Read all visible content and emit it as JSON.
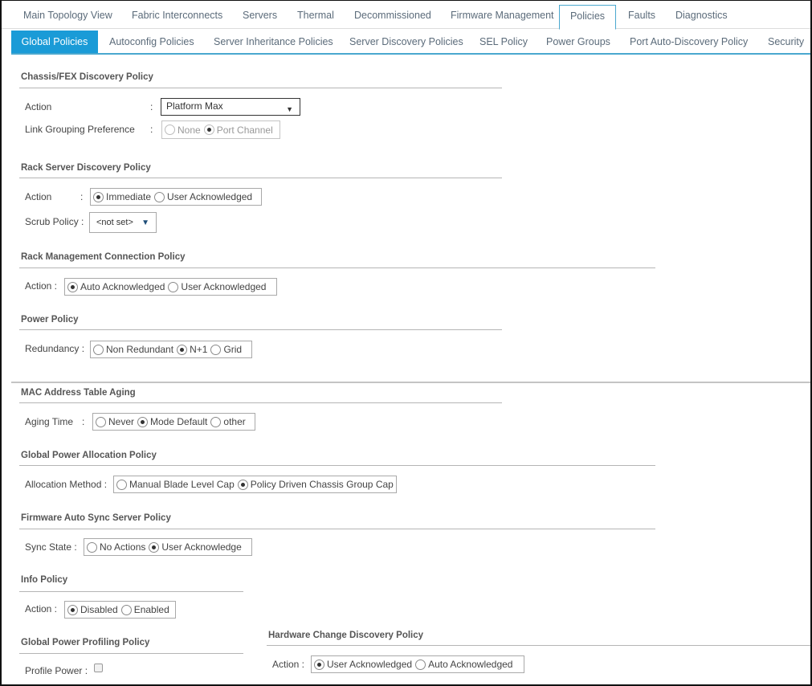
{
  "top_tabs": [
    {
      "label": "Main Topology View",
      "active": false
    },
    {
      "label": "Fabric Interconnects",
      "active": false
    },
    {
      "label": "Servers",
      "active": false
    },
    {
      "label": "Thermal",
      "active": false
    },
    {
      "label": "Decommissioned",
      "active": false
    },
    {
      "label": "Firmware Management",
      "active": false
    },
    {
      "label": "Policies",
      "active": true
    },
    {
      "label": "Faults",
      "active": false
    },
    {
      "label": "Diagnostics",
      "active": false
    }
  ],
  "sub_tabs": [
    {
      "label": "Global Policies",
      "active": true
    },
    {
      "label": "Autoconfig Policies",
      "active": false
    },
    {
      "label": "Server Inheritance Policies",
      "active": false
    },
    {
      "label": "Server Discovery Policies",
      "active": false
    },
    {
      "label": "SEL Policy",
      "active": false
    },
    {
      "label": "Power Groups",
      "active": false
    },
    {
      "label": "Port Auto-Discovery Policy",
      "active": false
    },
    {
      "label": "Security",
      "active": false
    }
  ],
  "accent_color": "#1a9bd7",
  "sections": {
    "chassis_fex": {
      "title": "Chassis/FEX Discovery Policy",
      "action_label": "Action",
      "action_value": "Platform Max",
      "link_grouping_label": "Link Grouping Preference",
      "link_grouping_options": [
        "None",
        "Port Channel"
      ],
      "link_grouping_selected": "Port Channel"
    },
    "rack_server_discovery": {
      "title": "Rack Server Discovery Policy",
      "action_label": "Action",
      "action_options": [
        "Immediate",
        "User Acknowledged"
      ],
      "action_selected": "Immediate",
      "scrub_label": "Scrub Policy :",
      "scrub_value": "<not set>"
    },
    "rack_mgmt_connection": {
      "title": "Rack Management Connection Policy",
      "action_label": "Action :",
      "action_options": [
        "Auto Acknowledged",
        "User Acknowledged"
      ],
      "action_selected": "Auto Acknowledged"
    },
    "power_policy": {
      "title": "Power Policy",
      "redundancy_label": "Redundancy :",
      "redundancy_options": [
        "Non Redundant",
        "N+1",
        "Grid"
      ],
      "redundancy_selected": "N+1"
    },
    "mac_aging": {
      "title": "MAC Address Table Aging",
      "aging_label": "Aging Time",
      "aging_options": [
        "Never",
        "Mode Default",
        "other"
      ],
      "aging_selected": "Mode Default"
    },
    "global_power_allocation": {
      "title": "Global Power Allocation Policy",
      "method_label": "Allocation Method :",
      "method_options": [
        "Manual Blade Level Cap",
        "Policy Driven Chassis Group Cap"
      ],
      "method_selected": "Policy Driven Chassis Group Cap"
    },
    "firmware_auto_sync": {
      "title": "Firmware Auto Sync Server Policy",
      "sync_label": "Sync State :",
      "sync_options": [
        "No Actions",
        "User Acknowledge"
      ],
      "sync_selected": "User Acknowledge"
    },
    "info_policy": {
      "title": "Info Policy",
      "action_label": "Action :",
      "action_options": [
        "Disabled",
        "Enabled"
      ],
      "action_selected": "Disabled"
    },
    "global_power_profiling": {
      "title": "Global Power Profiling Policy",
      "profile_label": "Profile Power :",
      "profile_checked": false
    },
    "hardware_change_discovery": {
      "title": "Hardware Change Discovery Policy",
      "action_label": "Action :",
      "action_options": [
        "User Acknowledged",
        "Auto Acknowledged"
      ],
      "action_selected": "User Acknowledged"
    }
  },
  "colon": ":"
}
